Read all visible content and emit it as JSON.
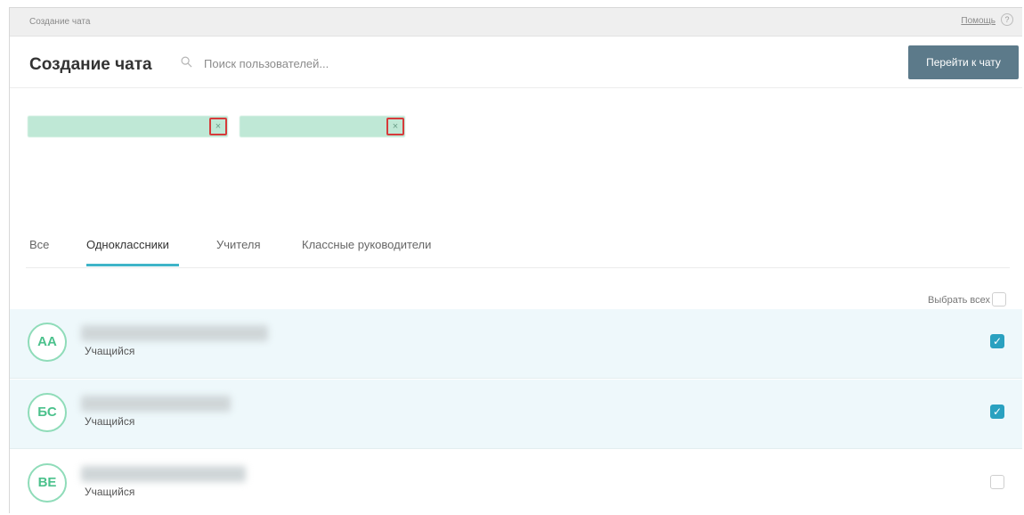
{
  "topbar": {
    "crumb": "Создание чата",
    "help": "Помощь",
    "help_icon": "?"
  },
  "header": {
    "title": "Создание чата",
    "search_placeholder": "Поиск пользователей...",
    "goto_button": "Перейти к чату"
  },
  "chips": [
    {
      "remove": "×"
    },
    {
      "remove": "×"
    }
  ],
  "tabs": [
    {
      "label": "Все"
    },
    {
      "label": "Одноклассники",
      "active": true
    },
    {
      "label": "Учителя"
    },
    {
      "label": "Классные руководители"
    }
  ],
  "select_all": "Выбрать всех",
  "users": [
    {
      "initials": "АА",
      "role": "Учащийся",
      "checked": true
    },
    {
      "initials": "БС",
      "role": "Учащийся",
      "checked": true
    },
    {
      "initials": "ВЕ",
      "role": "Учащийся",
      "checked": false
    }
  ],
  "colors": {
    "accent": "#2aa1c0",
    "tab_underline": "#3fb4c8",
    "avatar_border": "#8fdcb9",
    "button_bg": "#5c7a8a",
    "chip_bg": "#bfe8d6",
    "chip_remove_border": "#d63b3b",
    "selected_row_bg": "#eef8fb"
  }
}
